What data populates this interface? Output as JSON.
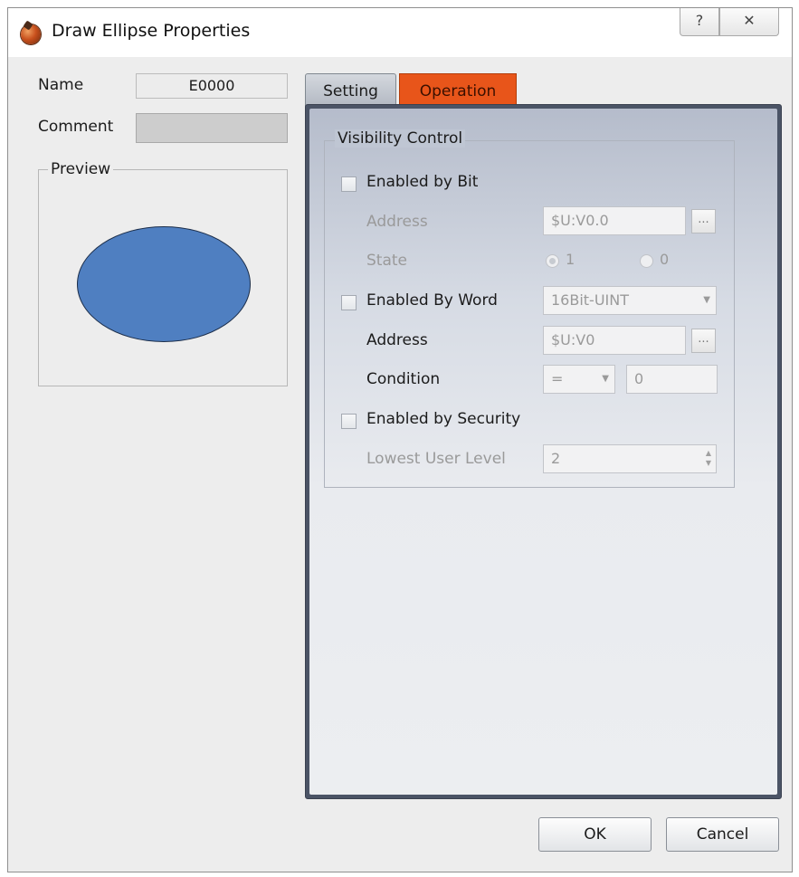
{
  "window": {
    "title": "Draw Ellipse Properties",
    "help_glyph": "?",
    "close_glyph": "✕"
  },
  "general": {
    "name_label": "Name",
    "name_value": "E0000",
    "comment_label": "Comment",
    "comment_value": "",
    "preview_label": "Preview"
  },
  "preview": {
    "shape": "ellipse",
    "fill_color": "#4f7fc1",
    "stroke_color": "#1c2e4a"
  },
  "tabs": [
    {
      "label": "Setting",
      "active": false
    },
    {
      "label": "Operation",
      "active": true
    }
  ],
  "visibility": {
    "group_label": "Visibility Control",
    "enabled_by_bit": {
      "label": "Enabled by Bit",
      "checked": false,
      "address_label": "Address",
      "address_value": "$U:V0.0",
      "state_label": "State",
      "state_options": [
        "1",
        "0"
      ],
      "state_selected": "1"
    },
    "enabled_by_word": {
      "label": "Enabled By Word",
      "checked": false,
      "type_value": "16Bit-UINT",
      "address_label": "Address",
      "address_value": "$U:V0",
      "condition_label": "Condition",
      "condition_operator": "=",
      "condition_value": "0"
    },
    "enabled_by_security": {
      "label": "Enabled by Security",
      "checked": false,
      "lowest_user_level_label": "Lowest User Level",
      "lowest_user_level_value": "2"
    }
  },
  "buttons": {
    "ok": "OK",
    "cancel": "Cancel",
    "browse_glyph": "..."
  },
  "colors": {
    "active_tab": "#e8551a",
    "panel_frame": "#4b5466"
  }
}
